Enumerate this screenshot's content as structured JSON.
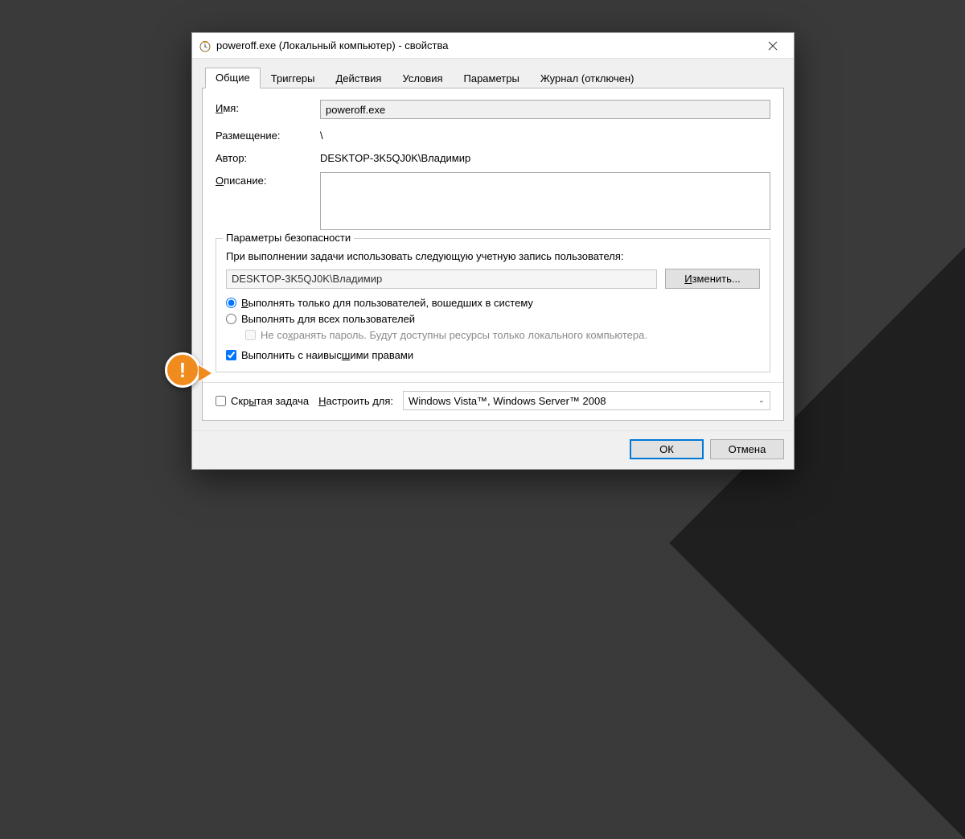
{
  "title": "poweroff.exe (Локальный компьютер) - свойства",
  "tabs": [
    {
      "label": "Общие"
    },
    {
      "label": "Триггеры"
    },
    {
      "label": "Действия"
    },
    {
      "label": "Условия"
    },
    {
      "label": "Параметры"
    },
    {
      "label": "Журнал (отключен)"
    }
  ],
  "general": {
    "name_label": "Имя:",
    "name_value": "poweroff.exe",
    "location_label": "Размещение:",
    "location_value": "\\",
    "author_label": "Автор:",
    "author_value": "DESKTOP-3K5QJ0K\\Владимир",
    "description_label": "Описание:",
    "description_value": ""
  },
  "security": {
    "legend": "Параметры безопасности",
    "intro": "При выполнении задачи использовать следующую учетную запись пользователя:",
    "account": "DESKTOP-3K5QJ0K\\Владимир",
    "change_button": "Изменить...",
    "radio_logged_on": "Выполнять только для пользователей, вошедших в систему",
    "radio_all_users": "Выполнять для всех пользователей",
    "no_store_password": "Не сохранять пароль. Будут доступны ресурсы только локального компьютера.",
    "highest_privileges": "Выполнить с наивысшими правами"
  },
  "footer": {
    "hidden_task": "Скрытая задача",
    "configure_for_label": "Настроить для:",
    "configure_for_value": "Windows Vista™, Windows Server™ 2008"
  },
  "buttons": {
    "ok": "ОК",
    "cancel": "Отмена"
  },
  "callout": {
    "symbol": "!"
  }
}
